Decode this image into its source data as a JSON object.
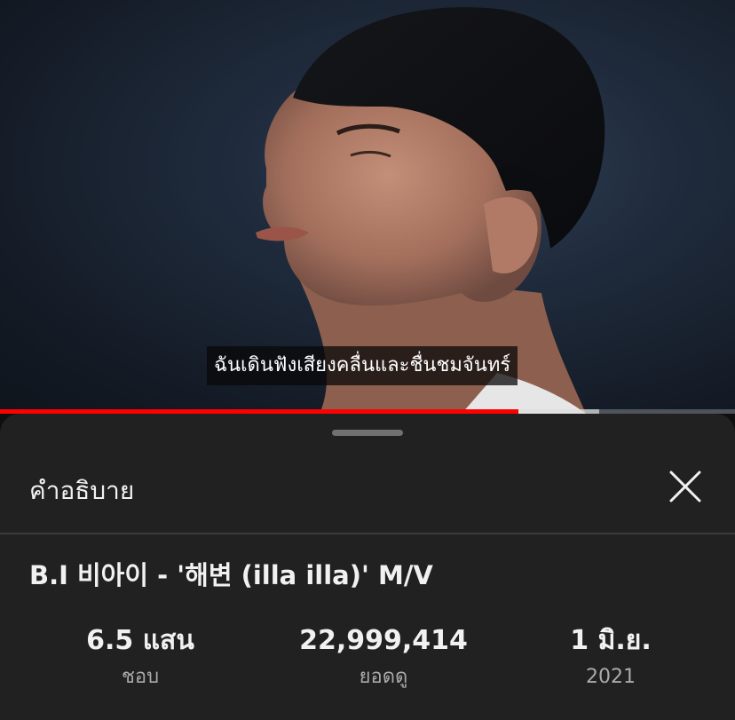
{
  "player": {
    "caption": "ฉันเดินฟังเสียงคลื่นและชื่นชมจันทร์",
    "progress_played_fraction": 0.705,
    "progress_buffered_fraction": 0.815,
    "colors": {
      "played": "#ff0000",
      "buffered": "#dcdcdc",
      "track": "#555555"
    }
  },
  "description_panel": {
    "title": "คำอธิบาย",
    "close_icon": "close-icon",
    "video_title": "B.I 비아이 - '해변 (illa illa)' M/V",
    "stats": {
      "likes_value": "6.5 แสน",
      "likes_label": "ชอบ",
      "views_value": "22,999,414",
      "views_label": "ยอดดู",
      "date_value": "1 มิ.ย.",
      "date_year": "2021"
    }
  }
}
